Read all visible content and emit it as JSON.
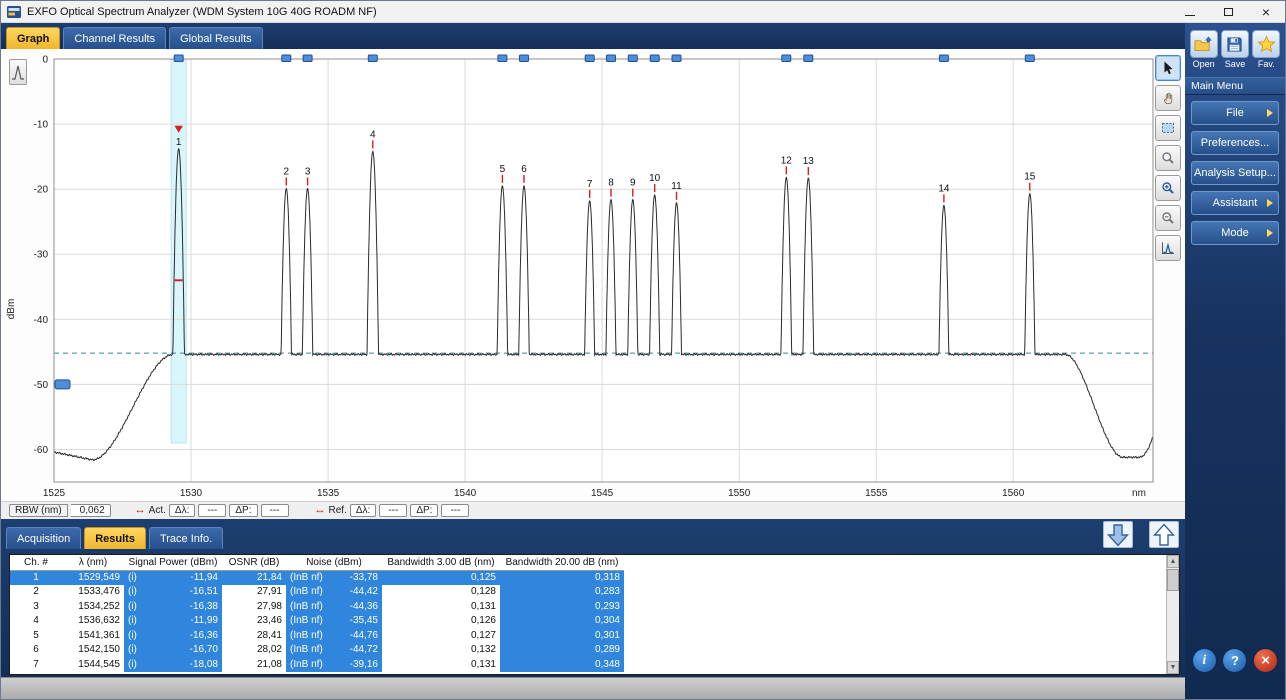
{
  "window": {
    "title": "EXFO Optical Spectrum Analyzer  (WDM System 10G 40G ROADM NF)"
  },
  "tabs_top": [
    {
      "label": "Graph",
      "active": true
    },
    {
      "label": "Channel Results",
      "active": false
    },
    {
      "label": "Global Results",
      "active": false
    }
  ],
  "tabs_bottom": [
    {
      "label": "Acquisition",
      "active": false
    },
    {
      "label": "Results",
      "active": true
    },
    {
      "label": "Trace Info.",
      "active": false
    }
  ],
  "status_bar": {
    "rbw_label": "RBW (nm)",
    "rbw_value": "0,062",
    "act_label": "Act.",
    "ref_label": "Ref.",
    "delta_lambda_label": "Δλ:",
    "delta_p_label": "ΔP:",
    "act_dl": "---",
    "act_dp": "---",
    "ref_dl": "---",
    "ref_dp": "---"
  },
  "sidebar": {
    "quick": [
      {
        "label": "Open"
      },
      {
        "label": "Save"
      },
      {
        "label": "Fav."
      }
    ],
    "menu_header": "Main Menu",
    "items": [
      {
        "label": "File",
        "arrow": true
      },
      {
        "label": "Preferences...",
        "arrow": false
      },
      {
        "label": "Analysis Setup...",
        "arrow": false
      },
      {
        "label": "Assistant",
        "arrow": true
      },
      {
        "label": "Mode",
        "arrow": true
      }
    ]
  },
  "table": {
    "headers": [
      "Ch. #",
      "λ (nm)",
      "Signal Power (dBm)",
      "OSNR (dB)",
      "Noise (dBm)",
      "Bandwidth 3.00 dB (nm)",
      "Bandwidth 20.00 dB (nm)"
    ],
    "rows": [
      [
        "1",
        "1529,549",
        "(i) -11,94",
        "21,84",
        "(InB nf) -33,78",
        "0,125",
        "0,318"
      ],
      [
        "2",
        "1533,476",
        "(i) -16,51",
        "27,91",
        "(InB nf) -44,42",
        "0,128",
        "0,283"
      ],
      [
        "3",
        "1534,252",
        "(i) -16,38",
        "27,98",
        "(InB nf) -44,36",
        "0,131",
        "0,293"
      ],
      [
        "4",
        "1536,632",
        "(i) -11,99",
        "23,46",
        "(InB nf) -35,45",
        "0,126",
        "0,304"
      ],
      [
        "5",
        "1541,361",
        "(i) -16,36",
        "28,41",
        "(InB nf) -44,76",
        "0,127",
        "0,301"
      ],
      [
        "6",
        "1542,150",
        "(i) -16,70",
        "28,02",
        "(InB nf) -44,72",
        "0,132",
        "0,289"
      ],
      [
        "7",
        "1544,545",
        "(i) -18,08",
        "21,08",
        "(InB nf) -39,16",
        "0,131",
        "0,348"
      ]
    ],
    "selected_row": 0,
    "highlight_cols": [
      2,
      4,
      6
    ]
  },
  "chart_data": {
    "type": "line",
    "xlabel": "nm",
    "ylabel": "dBm",
    "x_range": [
      1525,
      1565.1
    ],
    "y_range": [
      -65,
      0
    ],
    "x_ticks": [
      1525,
      1530,
      1535,
      1540,
      1545,
      1550,
      1555,
      1560
    ],
    "y_ticks": [
      0,
      -10,
      -20,
      -30,
      -40,
      -50,
      -60
    ],
    "grid": true,
    "noise_floor_dbm": -45.4,
    "threshold_line_dbm": -45.2,
    "axis_marker_dbm": -50,
    "selected_channel": 1,
    "selected_marker_dbm": -34,
    "selected_band": {
      "center": 1529.549,
      "width": 0.55
    },
    "left_edge": {
      "start_dbm": -60.4,
      "dip_dbm": -61.6,
      "rise_start": 1526.4,
      "rise_end": 1529.35
    },
    "right_edge": {
      "fall_start": 1561.9,
      "fall_end": 1564.0,
      "low_dbm": -61.2,
      "uptick_end_dbm": -58.0
    },
    "hwhm_nm": 0.065,
    "channels": [
      {
        "num": 1,
        "lambda": 1529.549,
        "peak_dbm": -13.8
      },
      {
        "num": 2,
        "lambda": 1533.476,
        "peak_dbm": -19.9
      },
      {
        "num": 3,
        "lambda": 1534.252,
        "peak_dbm": -19.9
      },
      {
        "num": 4,
        "lambda": 1536.632,
        "peak_dbm": -14.2
      },
      {
        "num": 5,
        "lambda": 1541.361,
        "peak_dbm": -19.5
      },
      {
        "num": 6,
        "lambda": 1542.15,
        "peak_dbm": -19.5
      },
      {
        "num": 7,
        "lambda": 1544.545,
        "peak_dbm": -21.8
      },
      {
        "num": 8,
        "lambda": 1545.322,
        "peak_dbm": -21.6
      },
      {
        "num": 9,
        "lambda": 1546.119,
        "peak_dbm": -21.6
      },
      {
        "num": 10,
        "lambda": 1546.917,
        "peak_dbm": -20.9
      },
      {
        "num": 11,
        "lambda": 1547.715,
        "peak_dbm": -22.1
      },
      {
        "num": 12,
        "lambda": 1551.721,
        "peak_dbm": -18.2
      },
      {
        "num": 13,
        "lambda": 1552.524,
        "peak_dbm": -18.3
      },
      {
        "num": 14,
        "lambda": 1557.47,
        "peak_dbm": -22.5
      },
      {
        "num": 15,
        "lambda": 1560.606,
        "peak_dbm": -20.7
      }
    ]
  }
}
